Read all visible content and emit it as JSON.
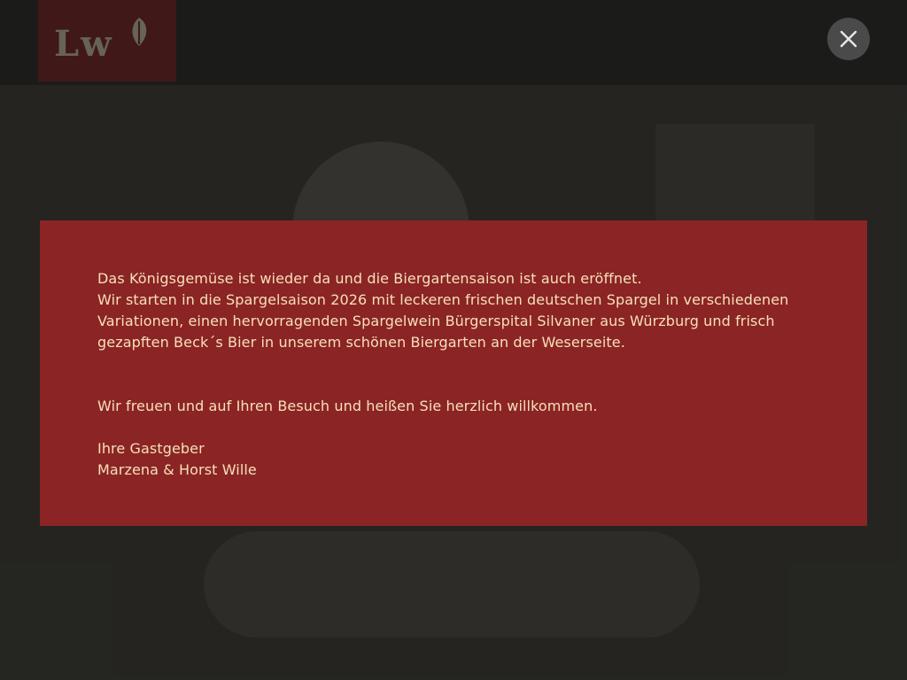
{
  "background": {
    "logo_text": "Lw"
  },
  "close_button": {
    "icon": "close-icon"
  },
  "modal": {
    "paragraph1_line1": "Das Königsgemüse ist wieder da und die Biergartensaison ist auch eröffnet.",
    "paragraph1_line2": "Wir starten in die Spargelsaison 2026 mit leckeren frischen deutschen Spargel in verschiedenen Variationen, einen hervorragenden Spargelwein Bürgerspital Silvaner aus Würzburg und frisch gezapften Beck´s Bier in unserem schönen Biergarten an der Weserseite.",
    "paragraph2": "Wir freuen und auf Ihren Besuch und heißen Sie herzlich willkommen.",
    "signoff_line1": "Ihre Gastgeber",
    "signoff_line2": "Marzena & Horst Wille"
  },
  "colors": {
    "modal_background": "#8b2425",
    "modal_text": "#f5e0b8",
    "overlay": "rgba(18,18,16,0.62)"
  }
}
